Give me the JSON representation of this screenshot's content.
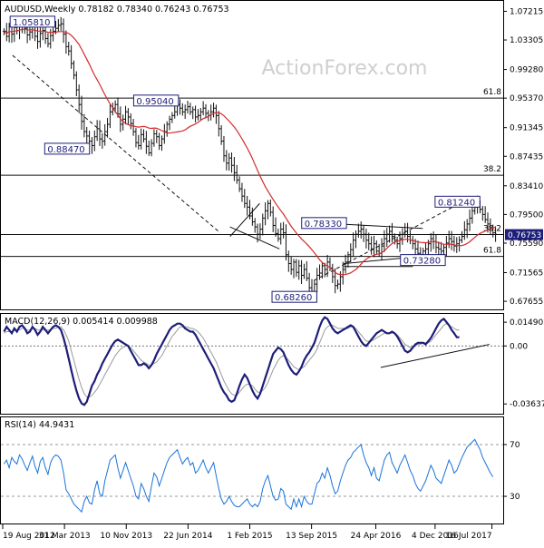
{
  "chart_data": [
    {
      "type": "candlestick",
      "title": "AUDUSD,Weekly",
      "ohlc_header": "0.78182 0.78340 0.76243 0.76753",
      "watermark": "ActionForex.com",
      "ylim": [
        0.6655,
        1.0851
      ],
      "y_ticks": [
        "1.07215",
        "1.03305",
        "0.99280",
        "0.95370",
        "0.91345",
        "0.87435",
        "0.83410",
        "0.79500",
        "0.75590",
        "0.71565",
        "0.67655"
      ],
      "x_tick_labels": [
        "19 Aug 2012",
        "31 Mar 2013",
        "10 Nov 2013",
        "22 Jun 2014",
        "1 Feb 2015",
        "13 Sep 2015",
        "24 Apr 2016",
        "4 Dec 2016",
        "16 Jul 2017"
      ],
      "current_price": "0.76753",
      "annotations": [
        "1.05810",
        "0.95040",
        "0.88470",
        "0.78330",
        "0.81240",
        "0.73280",
        "0.68260"
      ],
      "fib_labels": [
        "61.8",
        "38.2",
        "38.2",
        "61.8"
      ],
      "weekly_closes": [
        1.045,
        1.038,
        1.052,
        1.041,
        1.05,
        1.046,
        1.053,
        1.056,
        1.049,
        1.04,
        1.044,
        1.051,
        1.038,
        1.031,
        1.042,
        1.046,
        1.035,
        1.028,
        1.039,
        1.045,
        1.049,
        1.053,
        1.055,
        1.041,
        1.024,
        1.018,
        1.001,
        0.985,
        0.965,
        0.945,
        0.922,
        0.908,
        0.902,
        0.895,
        0.889,
        0.901,
        0.912,
        0.898,
        0.895,
        0.908,
        0.918,
        0.935,
        0.94,
        0.945,
        0.932,
        0.918,
        0.925,
        0.935,
        0.928,
        0.919,
        0.908,
        0.893,
        0.889,
        0.904,
        0.898,
        0.888,
        0.879,
        0.892,
        0.905,
        0.901,
        0.889,
        0.898,
        0.908,
        0.918,
        0.925,
        0.93,
        0.935,
        0.945,
        0.94,
        0.935,
        0.938,
        0.942,
        0.935,
        0.938,
        0.928,
        0.93,
        0.935,
        0.94,
        0.933,
        0.93,
        0.935,
        0.94,
        0.93,
        0.912,
        0.895,
        0.875,
        0.865,
        0.872,
        0.862,
        0.852,
        0.842,
        0.83,
        0.82,
        0.81,
        0.805,
        0.793,
        0.785,
        0.778,
        0.768,
        0.775,
        0.79,
        0.8,
        0.81,
        0.798,
        0.78,
        0.769,
        0.762,
        0.775,
        0.77,
        0.74,
        0.728,
        0.72,
        0.73,
        0.716,
        0.725,
        0.712,
        0.72,
        0.708,
        0.695,
        0.69,
        0.7,
        0.712,
        0.715,
        0.725,
        0.72,
        0.73,
        0.722,
        0.71,
        0.698,
        0.7,
        0.71,
        0.72,
        0.73,
        0.74,
        0.747,
        0.76,
        0.768,
        0.772,
        0.775,
        0.768,
        0.76,
        0.755,
        0.748,
        0.755,
        0.745,
        0.742,
        0.752,
        0.762,
        0.768,
        0.772,
        0.765,
        0.76,
        0.755,
        0.762,
        0.768,
        0.772,
        0.765,
        0.76,
        0.755,
        0.748,
        0.742,
        0.74,
        0.745,
        0.748,
        0.755,
        0.762,
        0.758,
        0.75,
        0.748,
        0.745,
        0.75,
        0.756,
        0.762,
        0.758,
        0.752,
        0.755,
        0.76,
        0.765,
        0.774,
        0.782,
        0.79,
        0.8,
        0.805,
        0.81,
        0.802,
        0.795,
        0.788,
        0.782,
        0.776,
        0.77,
        0.768
      ]
    },
    {
      "type": "line",
      "title": "MACD(12,26,9) 0.005414 0.009988",
      "y_tick_labels": [
        "0.014902",
        "0.00",
        "-0.036374"
      ],
      "ylim": [
        -0.0425,
        0.0201
      ],
      "series": [
        {
          "name": "MACD",
          "values": [
            0.009,
            0.012,
            0.01,
            0.008,
            0.011,
            0.009,
            0.012,
            0.013,
            0.011,
            0.008,
            0.009,
            0.012,
            0.01,
            0.007,
            0.009,
            0.012,
            0.01,
            0.008,
            0.01,
            0.012,
            0.013,
            0.012,
            0.01,
            0.005,
            -0.001,
            -0.008,
            -0.015,
            -0.022,
            -0.028,
            -0.033,
            -0.036,
            -0.037,
            -0.035,
            -0.03,
            -0.025,
            -0.022,
            -0.018,
            -0.015,
            -0.011,
            -0.008,
            -0.005,
            -0.002,
            0.001,
            0.003,
            0.004,
            0.003,
            0.002,
            0.001,
            0.0,
            -0.003,
            -0.006,
            -0.009,
            -0.012,
            -0.012,
            -0.011,
            -0.012,
            -0.014,
            -0.012,
            -0.009,
            -0.005,
            -0.002,
            0.001,
            0.004,
            0.007,
            0.01,
            0.012,
            0.013,
            0.014,
            0.014,
            0.013,
            0.011,
            0.01,
            0.009,
            0.009,
            0.007,
            0.004,
            0.001,
            -0.002,
            -0.005,
            -0.008,
            -0.011,
            -0.014,
            -0.018,
            -0.022,
            -0.026,
            -0.029,
            -0.031,
            -0.034,
            -0.035,
            -0.034,
            -0.03,
            -0.025,
            -0.021,
            -0.018,
            -0.02,
            -0.024,
            -0.028,
            -0.031,
            -0.033,
            -0.03,
            -0.025,
            -0.02,
            -0.015,
            -0.01,
            -0.005,
            -0.003,
            -0.001,
            -0.002,
            -0.004,
            -0.008,
            -0.012,
            -0.015,
            -0.017,
            -0.018,
            -0.016,
            -0.013,
            -0.009,
            -0.006,
            -0.004,
            -0.001,
            0.002,
            0.007,
            0.012,
            0.016,
            0.018,
            0.017,
            0.014,
            0.011,
            0.009,
            0.008,
            0.009,
            0.01,
            0.011,
            0.012,
            0.013,
            0.012,
            0.009,
            0.006,
            0.003,
            0.001,
            0.0,
            0.002,
            0.004,
            0.006,
            0.008,
            0.009,
            0.01,
            0.009,
            0.008,
            0.008,
            0.009,
            0.008,
            0.006,
            0.003,
            0.0,
            -0.003,
            -0.004,
            -0.003,
            -0.001,
            0.001,
            0.002,
            0.002,
            0.002,
            0.001,
            0.003,
            0.005,
            0.008,
            0.011,
            0.014,
            0.016,
            0.017,
            0.015,
            0.013,
            0.01,
            0.008,
            0.0055,
            0.0055
          ]
        },
        {
          "name": "Signal",
          "values": [
            0.008,
            0.009,
            0.009,
            0.009,
            0.01,
            0.01,
            0.01,
            0.011,
            0.011,
            0.01,
            0.01,
            0.011,
            0.011,
            0.01,
            0.01,
            0.01,
            0.01,
            0.01,
            0.01,
            0.011,
            0.011,
            0.012,
            0.012,
            0.01,
            0.007,
            0.003,
            -0.003,
            -0.009,
            -0.015,
            -0.021,
            -0.026,
            -0.03,
            -0.032,
            -0.032,
            -0.031,
            -0.029,
            -0.027,
            -0.024,
            -0.021,
            -0.018,
            -0.015,
            -0.012,
            -0.009,
            -0.006,
            -0.004,
            -0.002,
            -0.001,
            0.0,
            0.0,
            -0.001,
            -0.003,
            -0.005,
            -0.007,
            -0.009,
            -0.01,
            -0.011,
            -0.012,
            -0.012,
            -0.011,
            -0.01,
            -0.008,
            -0.006,
            -0.003,
            0.0,
            0.003,
            0.006,
            0.008,
            0.01,
            0.012,
            0.012,
            0.012,
            0.012,
            0.011,
            0.011,
            0.01,
            0.009,
            0.007,
            0.005,
            0.002,
            -0.001,
            -0.004,
            -0.007,
            -0.01,
            -0.014,
            -0.018,
            -0.022,
            -0.025,
            -0.028,
            -0.03,
            -0.031,
            -0.031,
            -0.029,
            -0.027,
            -0.025,
            -0.024,
            -0.024,
            -0.025,
            -0.027,
            -0.029,
            -0.029,
            -0.028,
            -0.026,
            -0.023,
            -0.019,
            -0.015,
            -0.012,
            -0.009,
            -0.007,
            -0.006,
            -0.007,
            -0.009,
            -0.011,
            -0.013,
            -0.014,
            -0.015,
            -0.014,
            -0.013,
            -0.011,
            -0.009,
            -0.007,
            -0.005,
            -0.002,
            0.002,
            0.006,
            0.01,
            0.012,
            0.013,
            0.013,
            0.012,
            0.011,
            0.011,
            0.011,
            0.011,
            0.011,
            0.012,
            0.012,
            0.011,
            0.009,
            0.007,
            0.005,
            0.003,
            0.003,
            0.003,
            0.004,
            0.005,
            0.006,
            0.007,
            0.008,
            0.008,
            0.008,
            0.008,
            0.008,
            0.007,
            0.005,
            0.003,
            0.001,
            0.0,
            -0.001,
            -0.001,
            0.0,
            0.001,
            0.001,
            0.002,
            0.002,
            0.002,
            0.003,
            0.005,
            0.007,
            0.009,
            0.011,
            0.013,
            0.014,
            0.013,
            0.012,
            0.011,
            0.01,
            0.01
          ]
        }
      ]
    },
    {
      "type": "line",
      "title": "RSI(14) 44.9431",
      "y_tick_labels": [
        "70",
        "30"
      ],
      "ylim": [
        9,
        91
      ],
      "series": [
        {
          "name": "RSI",
          "values": [
            55,
            58,
            52,
            60,
            57,
            55,
            62,
            59,
            54,
            50,
            56,
            61,
            53,
            48,
            57,
            60,
            52,
            47,
            56,
            60,
            62,
            61,
            58,
            48,
            35,
            32,
            28,
            24,
            22,
            20,
            18,
            26,
            30,
            25,
            24,
            35,
            42,
            32,
            30,
            42,
            50,
            58,
            60,
            62,
            52,
            44,
            50,
            56,
            50,
            44,
            38,
            30,
            28,
            40,
            36,
            30,
            26,
            38,
            48,
            45,
            38,
            44,
            50,
            56,
            60,
            62,
            64,
            66,
            60,
            55,
            58,
            60,
            54,
            56,
            48,
            50,
            54,
            58,
            52,
            48,
            52,
            56,
            46,
            36,
            28,
            24,
            26,
            30,
            26,
            23,
            22,
            22,
            24,
            26,
            28,
            24,
            22,
            24,
            22,
            26,
            36,
            42,
            46,
            38,
            30,
            27,
            28,
            36,
            34,
            24,
            22,
            20,
            28,
            22,
            28,
            22,
            30,
            26,
            24,
            24,
            32,
            40,
            42,
            48,
            44,
            52,
            46,
            38,
            32,
            34,
            42,
            48,
            54,
            58,
            60,
            64,
            66,
            68,
            70,
            62,
            56,
            52,
            46,
            52,
            44,
            42,
            50,
            58,
            62,
            64,
            56,
            52,
            48,
            54,
            58,
            62,
            56,
            50,
            46,
            40,
            36,
            34,
            38,
            42,
            48,
            54,
            50,
            44,
            42,
            40,
            46,
            52,
            58,
            54,
            48,
            50,
            55,
            60,
            64,
            68,
            70,
            72,
            74,
            70,
            66,
            60,
            56,
            52,
            48,
            45
          ]
        }
      ]
    }
  ]
}
